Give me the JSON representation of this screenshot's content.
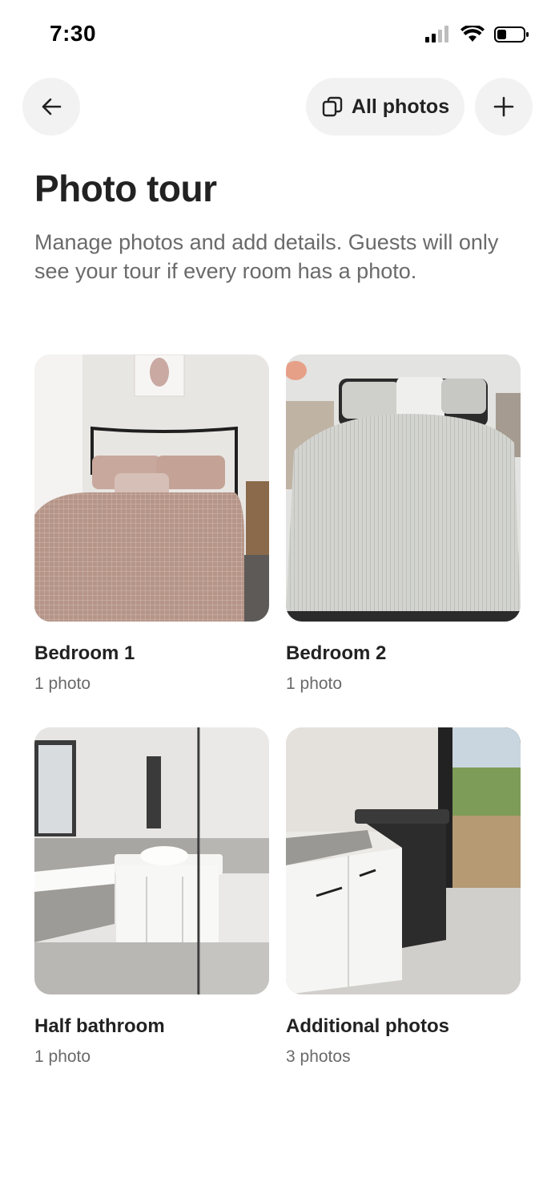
{
  "status_bar": {
    "time": "7:30",
    "icons": [
      "signal-icon",
      "wifi-icon",
      "battery-icon"
    ]
  },
  "nav": {
    "back_icon": "arrow-left-icon",
    "all_photos_label": "All photos",
    "all_photos_icon": "photo-stack-icon",
    "add_icon": "plus-icon"
  },
  "header": {
    "title": "Photo tour",
    "subtitle": "Manage photos and add details. Guests will only see your tour if every room has a photo."
  },
  "rooms": [
    {
      "name": "Bedroom 1",
      "count": "1 photo",
      "image": "bedroom-photo"
    },
    {
      "name": "Bedroom 2",
      "count": "1 photo",
      "image": "bedroom-photo"
    },
    {
      "name": "Half bathroom",
      "count": "1 photo",
      "image": "bathroom-photo"
    },
    {
      "name": "Additional photos",
      "count": "3 photos",
      "image": "laundry-photo"
    }
  ],
  "colors": {
    "text_primary": "#222222",
    "text_secondary": "#6a6a6a",
    "button_bg": "#f2f2f2"
  }
}
